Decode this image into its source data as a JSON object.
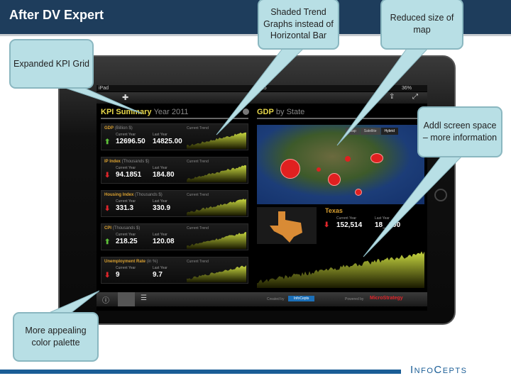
{
  "slide": {
    "title": "After DV Expert",
    "footer_logo": "InfoCepts",
    "footer_color": "#1a5d96"
  },
  "ipad": {
    "status_left": "iPad",
    "status_time": "2:15",
    "status_battery": "36%",
    "kpi": {
      "title": "KPI Summary",
      "year": "Year 2011",
      "trend_label": "Current Trend",
      "current_label": "Current Year",
      "last_label": "Last Year",
      "cards": [
        {
          "name": "GDP",
          "unit": "(Billion $)",
          "current": "12696.50",
          "last": "14825.00",
          "direction": "up"
        },
        {
          "name": "IP Index",
          "unit": "(Thousands $)",
          "current": "94.1851",
          "last": "184.80",
          "direction": "down"
        },
        {
          "name": "Housing Index",
          "unit": "(Thousands $)",
          "current": "331.3",
          "last": "330.9",
          "direction": "down"
        },
        {
          "name": "CPI",
          "unit": "(Thousands $)",
          "current": "218.25",
          "last": "120.08",
          "direction": "up"
        },
        {
          "name": "Unemployment Rate",
          "unit": "(in %)",
          "current": "9",
          "last": "9.7",
          "direction": "down"
        }
      ]
    },
    "gdp": {
      "title": "GDP",
      "subtitle": "by State",
      "map_tabs": [
        "Map",
        "Satellite",
        "Hybrid"
      ],
      "state": "Texas",
      "current_label": "Current Year",
      "last_label": "Last Year",
      "current": "152,514",
      "last": "18_,000",
      "direction": "down"
    },
    "bottom_bar": {
      "created_by": "Created by",
      "created_logo": "InfoCepts",
      "powered_by": "Powered by",
      "powered_logo": "MicroStrategy"
    },
    "colors": {
      "up": "#5fc23a",
      "down": "#e0262b",
      "trend": "#c8d840",
      "title": "#e8d84a"
    }
  },
  "callouts": {
    "kpi": "Expanded KPI Grid",
    "trend": "Shaded Trend Graphs instead of Horizontal Bar",
    "map": "Reduced size of map",
    "space": "Addl screen space – more information",
    "palette": "More appealing color palette"
  }
}
